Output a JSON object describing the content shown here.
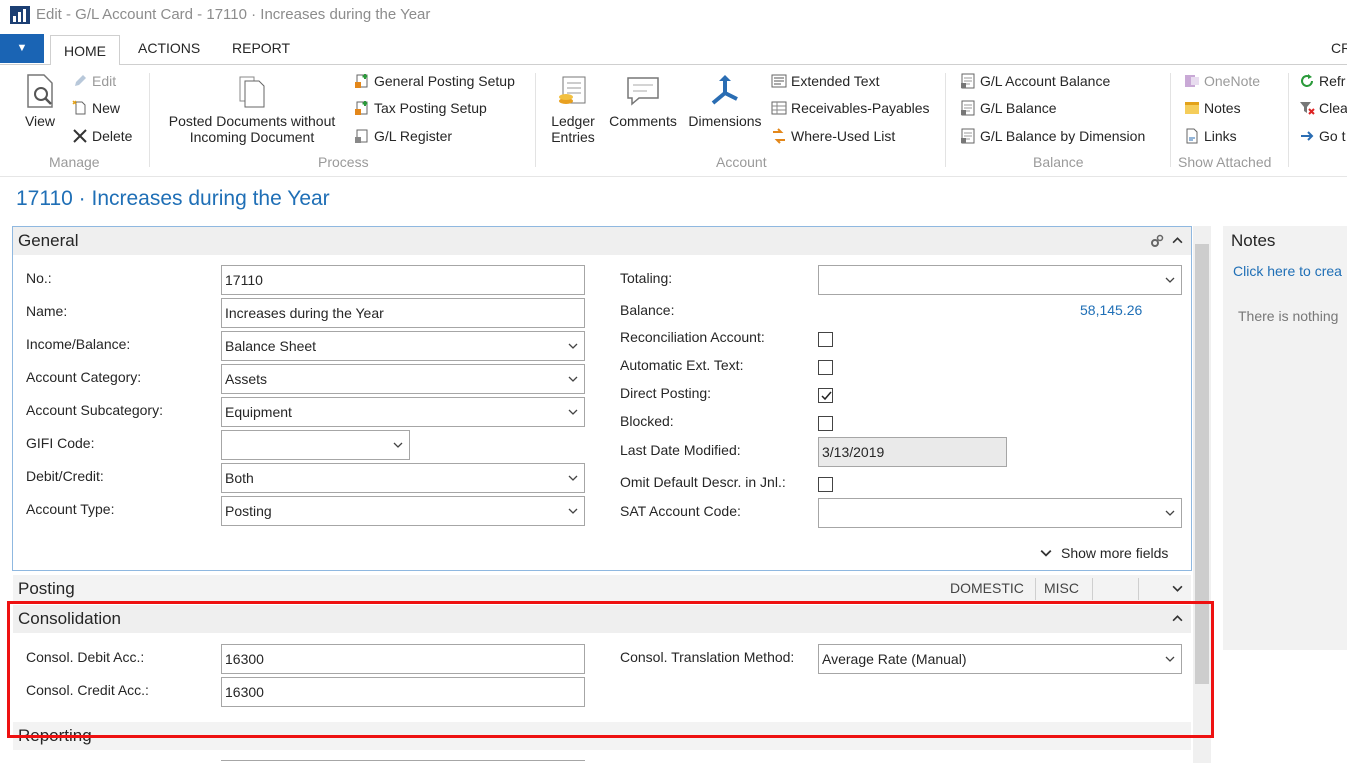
{
  "window": {
    "title": "Edit - G/L Account Card - 17110 · Increases during the Year"
  },
  "menu_tabs": [
    "HOME",
    "ACTIONS",
    "REPORT"
  ],
  "menu_right_label": "CR",
  "ribbon": {
    "manage": {
      "group_label": "Manage",
      "view": "View",
      "edit": "Edit",
      "new": "New",
      "delete": "Delete"
    },
    "process": {
      "group_label": "Process",
      "posted_docs_line1": "Posted Documents without",
      "posted_docs_line2": "Incoming Document",
      "general_posting_setup": "General Posting Setup",
      "tax_posting_setup": "Tax Posting Setup",
      "gl_register": "G/L Register"
    },
    "account": {
      "group_label": "Account",
      "ledger_line1": "Ledger",
      "ledger_line2": "Entries",
      "comments": "Comments",
      "dimensions": "Dimensions",
      "extended_text": "Extended Text",
      "receivables_payables": "Receivables-Payables",
      "where_used": "Where-Used List"
    },
    "balance": {
      "group_label": "Balance",
      "gl_account_balance": "G/L Account Balance",
      "gl_balance": "G/L Balance",
      "gl_balance_dim": "G/L Balance by Dimension"
    },
    "show_attached": {
      "group_label": "Show Attached",
      "onenote": "OneNote",
      "notes": "Notes",
      "links": "Links"
    },
    "page": {
      "refresh": "Refr",
      "clear": "Clea",
      "goto": "Go t"
    }
  },
  "page_title": "17110 · Increases during the Year",
  "general": {
    "header": "General",
    "no_label": "No.:",
    "no_value": "17110",
    "name_label": "Name:",
    "name_value": "Increases during the Year",
    "income_balance_label": "Income/Balance:",
    "income_balance_value": "Balance Sheet",
    "account_category_label": "Account Category:",
    "account_category_value": "Assets",
    "account_subcategory_label": "Account Subcategory:",
    "account_subcategory_value": "Equipment",
    "gifi_label": "GIFI Code:",
    "gifi_value": "",
    "debit_credit_label": "Debit/Credit:",
    "debit_credit_value": "Both",
    "account_type_label": "Account Type:",
    "account_type_value": "Posting",
    "totaling_label": "Totaling:",
    "totaling_value": "",
    "balance_label": "Balance:",
    "balance_value": "58,145.26",
    "reconciliation_label": "Reconciliation Account:",
    "reconciliation_checked": false,
    "auto_ext_text_label": "Automatic Ext. Text:",
    "auto_ext_text_checked": false,
    "direct_posting_label": "Direct Posting:",
    "direct_posting_checked": true,
    "blocked_label": "Blocked:",
    "blocked_checked": false,
    "last_modified_label": "Last Date Modified:",
    "last_modified_value": "3/13/2019",
    "omit_default_label": "Omit Default Descr. in Jnl.:",
    "omit_default_checked": false,
    "sat_code_label": "SAT Account Code:",
    "sat_code_value": "",
    "show_more": "Show more fields"
  },
  "posting": {
    "header": "Posting",
    "tag1": "DOMESTIC",
    "tag2": "MISC"
  },
  "consolidation": {
    "header": "Consolidation",
    "debit_label": "Consol. Debit Acc.:",
    "debit_value": "16300",
    "credit_label": "Consol. Credit Acc.:",
    "credit_value": "16300",
    "translation_label": "Consol. Translation Method:",
    "translation_value": "Average Rate (Manual)"
  },
  "reporting": {
    "header": "Reporting"
  },
  "notes_panel": {
    "title": "Notes",
    "create_link": "Click here to crea",
    "empty_text": "There is nothing"
  },
  "colors": {
    "accent": "#1f6fb6",
    "highlight": "#ee1111",
    "menu_button": "#1a64b4"
  }
}
